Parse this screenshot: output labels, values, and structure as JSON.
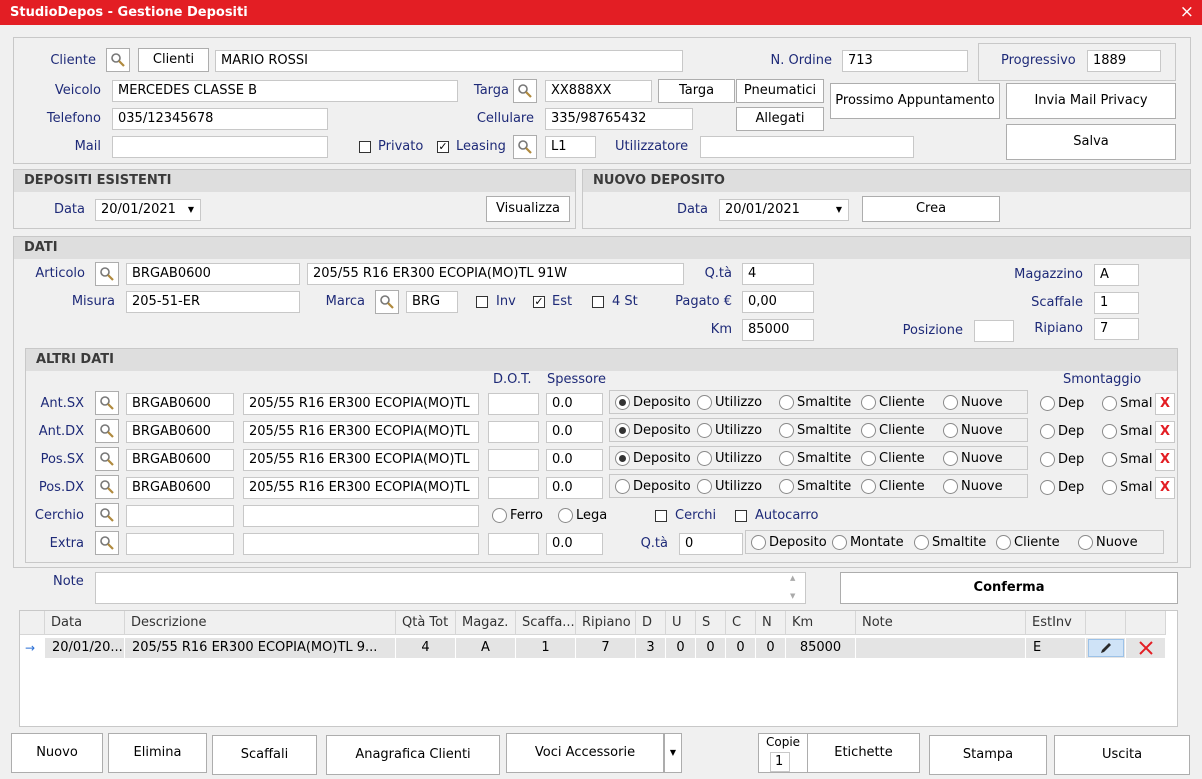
{
  "window": {
    "title": "StudioDepos - Gestione Depositi",
    "close": "×"
  },
  "header": {
    "cliente_label": "Cliente",
    "clienti_button": "Clienti",
    "cliente_value": "MARIO ROSSI",
    "n_ordine_label": "N. Ordine",
    "n_ordine_value": "713",
    "progressivo_label": "Progressivo",
    "progressivo_value": "1889",
    "veicolo_label": "Veicolo",
    "veicolo_value": "MERCEDES CLASSE B",
    "targa_label": "Targa",
    "targa_value": "XX888XX",
    "targa_button": "Targa",
    "pneumatici_button": "Pneumatici",
    "prossimo_button": "Prossimo Appuntamento",
    "invia_mail_button": "Invia Mail Privacy",
    "telefono_label": "Telefono",
    "telefono_value": "035/12345678",
    "cellulare_label": "Cellulare",
    "cellulare_value": "335/98765432",
    "allegati_button": "Allegati",
    "mail_label": "Mail",
    "mail_value": "",
    "privato_label": "Privato",
    "privato_checked": false,
    "leasing_label": "Leasing",
    "leasing_checked": true,
    "leasing_value": "L1",
    "utilizzatore_label": "Utilizzatore",
    "utilizzatore_value": "",
    "salva_button": "Salva"
  },
  "depositi_esistenti": {
    "title": "DEPOSITI ESISTENTI",
    "data_label": "Data",
    "data_value": "20/01/2021",
    "visualizza_button": "Visualizza"
  },
  "nuovo_deposito": {
    "title": "NUOVO DEPOSITO",
    "data_label": "Data",
    "data_value": "20/01/2021",
    "crea_button": "Crea"
  },
  "dati": {
    "title": "DATI",
    "articolo_label": "Articolo",
    "articolo_code": "BRGAB0600",
    "articolo_desc": "205/55 R16  ER300 ECOPIA(MO)TL      91W",
    "qta_label": "Q.tà",
    "qta_value": "4",
    "magazzino_label": "Magazzino",
    "magazzino_value": "A",
    "misura_label": "Misura",
    "misura_value": "205-51-ER",
    "marca_label": "Marca",
    "marca_value": "BRG",
    "inv_label": "Inv",
    "inv_checked": false,
    "est_label": "Est",
    "est_checked": true,
    "st4_label": "4 St",
    "st4_checked": false,
    "pagato_label": "Pagato €",
    "pagato_value": "0,00",
    "scaffale_label": "Scaffale",
    "scaffale_value": "1",
    "km_label": "Km",
    "km_value": "85000",
    "posizione_label": "Posizione",
    "posizione_value": "",
    "ripiano_label": "Ripiano",
    "ripiano_value": "7"
  },
  "altri_dati": {
    "title": "ALTRI DATI",
    "dot_header": "D.O.T.",
    "spessore_header": "Spessore",
    "smontaggio_header": "Smontaggio",
    "options": [
      "Deposito",
      "Utilizzo",
      "Smaltite",
      "Cliente",
      "Nuove"
    ],
    "smont_options": [
      "Dep",
      "Smal"
    ],
    "x_label": "X",
    "rows": [
      {
        "label": "Ant.SX",
        "code": "BRGAB0600",
        "desc": "205/55 R16  ER300 ECOPIA(MO)TL",
        "dot": "",
        "spessore": "0.0",
        "selected": 0
      },
      {
        "label": "Ant.DX",
        "code": "BRGAB0600",
        "desc": "205/55 R16  ER300 ECOPIA(MO)TL",
        "dot": "",
        "spessore": "0.0",
        "selected": 0
      },
      {
        "label": "Pos.SX",
        "code": "BRGAB0600",
        "desc": "205/55 R16  ER300 ECOPIA(MO)TL",
        "dot": "",
        "spessore": "0.0",
        "selected": 0
      },
      {
        "label": "Pos.DX",
        "code": "BRGAB0600",
        "desc": "205/55 R16  ER300 ECOPIA(MO)TL",
        "dot": "",
        "spessore": "0.0",
        "selected": -1
      }
    ],
    "cerchio_label": "Cerchio",
    "ferro_label": "Ferro",
    "lega_label": "Lega",
    "cerchi_label": "Cerchi",
    "autocarro_label": "Autocarro",
    "extra_label": "Extra",
    "extra_spessore": "0.0",
    "extra_qta_label": "Q.tà",
    "extra_qta_value": "0",
    "extra_options": [
      "Deposito",
      "Montate",
      "Smaltite",
      "Cliente",
      "Nuove"
    ]
  },
  "note": {
    "label": "Note",
    "value": "",
    "conferma_button": "Conferma"
  },
  "grid": {
    "columns": [
      "Data",
      "Descrizione",
      "Qtà Tot",
      "Magaz.",
      "Scaffa...",
      "Ripiano",
      "D",
      "U",
      "S",
      "C",
      "N",
      "Km",
      "Note",
      "EstInv"
    ],
    "rows": [
      {
        "arrow": "→",
        "data": "20/01/20...",
        "descrizione": "205/55 R16  ER300 ECOPIA(MO)TL     9...",
        "qta": "4",
        "magaz": "A",
        "scaffale": "1",
        "ripiano": "7",
        "d": "3",
        "u": "0",
        "s": "0",
        "c": "0",
        "n": "0",
        "km": "85000",
        "note": "",
        "estinv": "E"
      }
    ]
  },
  "footer": {
    "nuovo": "Nuovo",
    "elimina": "Elimina",
    "scaffali": "Scaffali",
    "anagrafica": "Anagrafica Clienti",
    "voci": "Voci Accessorie",
    "copie_label": "Copie",
    "copie_value": "1",
    "etichette": "Etichette",
    "stampa": "Stampa",
    "uscita": "Uscita"
  }
}
